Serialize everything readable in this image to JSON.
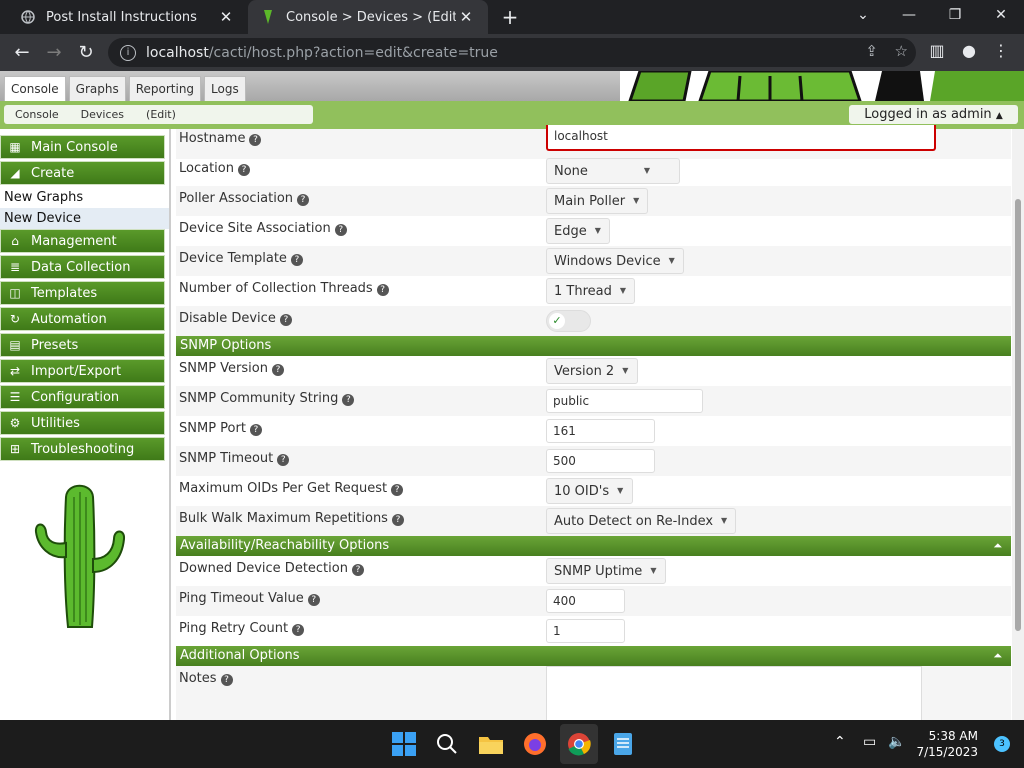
{
  "browser": {
    "tabs": [
      {
        "title": "Post Install Instructions",
        "active": false
      },
      {
        "title": "Console > Devices > (Edit)",
        "active": true
      }
    ],
    "url_host": "localhost",
    "url_path": "/cacti/host.php?action=edit&create=true"
  },
  "app": {
    "top_tabs": [
      "Console",
      "Graphs",
      "Reporting",
      "Logs"
    ],
    "breadcrumbs": [
      "Console",
      "Devices",
      "(Edit)"
    ],
    "logged_in": "Logged in as admin"
  },
  "sidebar": {
    "items": [
      {
        "label": "Main Console",
        "icon": "map-icon"
      },
      {
        "label": "Create",
        "icon": "chart-icon"
      },
      {
        "label": "New Graphs",
        "sub": true
      },
      {
        "label": "New Device",
        "sub": true,
        "selected": true
      },
      {
        "label": "Management",
        "icon": "home-icon"
      },
      {
        "label": "Data Collection",
        "icon": "database-icon"
      },
      {
        "label": "Templates",
        "icon": "layers-icon"
      },
      {
        "label": "Automation",
        "icon": "automation-icon"
      },
      {
        "label": "Presets",
        "icon": "archive-icon"
      },
      {
        "label": "Import/Export",
        "icon": "exchange-icon"
      },
      {
        "label": "Configuration",
        "icon": "sliders-icon"
      },
      {
        "label": "Utilities",
        "icon": "cogs-icon"
      },
      {
        "label": "Troubleshooting",
        "icon": "sitemap-icon"
      }
    ]
  },
  "form": {
    "hostname": {
      "label": "Hostname",
      "value": "localhost"
    },
    "location": {
      "label": "Location",
      "value": "None"
    },
    "poller": {
      "label": "Poller Association",
      "value": "Main Poller"
    },
    "site": {
      "label": "Device Site Association",
      "value": "Edge"
    },
    "template": {
      "label": "Device Template",
      "value": "Windows Device"
    },
    "threads": {
      "label": "Number of Collection Threads",
      "value": "1 Thread"
    },
    "disable": {
      "label": "Disable Device"
    },
    "snmp_section": "SNMP Options",
    "snmp_version": {
      "label": "SNMP Version",
      "value": "Version 2"
    },
    "snmp_community": {
      "label": "SNMP Community String",
      "value": "public"
    },
    "snmp_port": {
      "label": "SNMP Port",
      "value": "161"
    },
    "snmp_timeout": {
      "label": "SNMP Timeout",
      "value": "500"
    },
    "max_oids": {
      "label": "Maximum OIDs Per Get Request",
      "value": "10 OID's"
    },
    "bulk_walk": {
      "label": "Bulk Walk Maximum Repetitions",
      "value": "Auto Detect on Re-Index"
    },
    "avail_section": "Availability/Reachability Options",
    "downed": {
      "label": "Downed Device Detection",
      "value": "SNMP Uptime"
    },
    "ping_timeout": {
      "label": "Ping Timeout Value",
      "value": "400"
    },
    "ping_retry": {
      "label": "Ping Retry Count",
      "value": "1"
    },
    "additional_section": "Additional Options",
    "notes": {
      "label": "Notes",
      "value": ""
    }
  },
  "taskbar": {
    "time": "5:38 AM",
    "date": "7/15/2023",
    "notifications": "3"
  }
}
